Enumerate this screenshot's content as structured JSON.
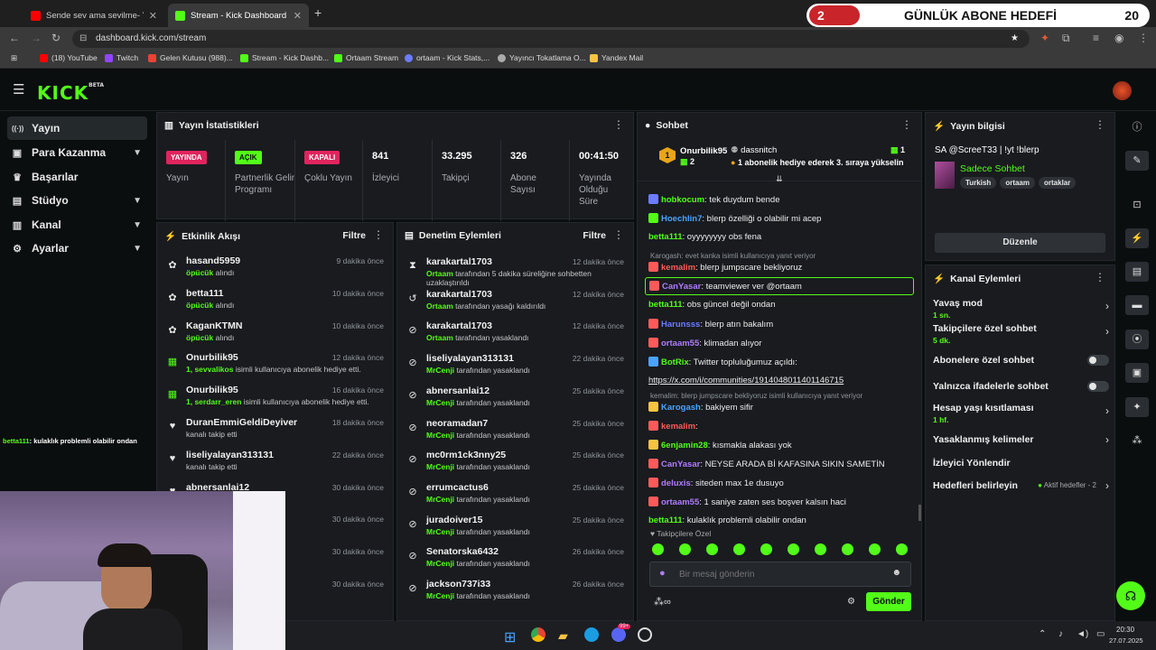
{
  "browser": {
    "tabs": [
      {
        "title": "Sende sev ama sevilme- Yıldız T",
        "active": false,
        "favicon_color": "#ff0000"
      },
      {
        "title": "Stream - Kick Dashboard",
        "active": true,
        "favicon_color": "#53fc18"
      }
    ],
    "url": "dashboard.kick.com/stream",
    "bookmarks": [
      {
        "label": "(18) YouTube",
        "color": "#ff0000"
      },
      {
        "label": "Twitch",
        "color": "#9146ff"
      },
      {
        "label": "Gelen Kutusu (988)...",
        "color": "#ea4335"
      },
      {
        "label": "Stream - Kick Dashb...",
        "color": "#53fc18"
      },
      {
        "label": "Ortaam Stream",
        "color": "#53fc18"
      },
      {
        "label": "ortaam - Kick Stats,...",
        "color": "#6b7cff"
      },
      {
        "label": "Yayıncı Tokatlama O...",
        "color": "#aaaaaa"
      },
      {
        "label": "Yandex Mail",
        "color": "#f6c343"
      }
    ]
  },
  "goal_overlay": {
    "number": "2",
    "label": "GÜNLÜK ABONE HEDEFİ",
    "count": "20"
  },
  "logo": {
    "text": "KICK",
    "beta": "BETA"
  },
  "nav": [
    {
      "label": "Yayın",
      "icon": "radio-icon",
      "glyph": "((·))",
      "active": true,
      "chevron": false
    },
    {
      "label": "Para Kazanma",
      "icon": "money-icon",
      "glyph": "▣",
      "active": false,
      "chevron": true
    },
    {
      "label": "Başarılar",
      "icon": "trophy-icon",
      "glyph": "♛",
      "active": false,
      "chevron": false
    },
    {
      "label": "Stüdyo",
      "icon": "studio-icon",
      "glyph": "▤",
      "active": false,
      "chevron": true
    },
    {
      "label": "Kanal",
      "icon": "channel-icon",
      "glyph": "▥",
      "active": false,
      "chevron": true
    },
    {
      "label": "Ayarlar",
      "icon": "settings-icon",
      "glyph": "⚙",
      "active": false,
      "chevron": true
    }
  ],
  "stats_panel": {
    "title": "Yayın İstatistikleri",
    "items": [
      {
        "badge": "YAYINDA",
        "badge_color": "#e0245e",
        "label": "Yayın"
      },
      {
        "badge": "AÇIK",
        "badge_color": "#53fc18",
        "label": "Partnerlik Gelir Programı"
      },
      {
        "badge": "KAPALI",
        "badge_color": "#e0245e",
        "label": "Çoklu Yayın"
      },
      {
        "value": "841",
        "label": "İzleyici"
      },
      {
        "value": "33.295",
        "label": "Takipçi"
      },
      {
        "value": "326",
        "label": "Abone Sayısı"
      },
      {
        "value": "00:41:50",
        "label": "Yayında Olduğu Süre"
      }
    ]
  },
  "activity": {
    "title": "Etkinlik Akışı",
    "filter": "Filtre",
    "rows": [
      {
        "name": "hasand5959",
        "sub_hl": "öpücük",
        "sub": " alındı",
        "time": "9 dakika önce",
        "icon": "gift-icon",
        "glyph": "✿"
      },
      {
        "name": "betta111",
        "sub_hl": "öpücük",
        "sub": " alındı",
        "time": "10 dakika önce",
        "icon": "gift-icon",
        "glyph": "✿"
      },
      {
        "name": "KaganKTMN",
        "sub_hl": "öpücük",
        "sub": " alındı",
        "time": "10 dakika önce",
        "icon": "gift-icon",
        "glyph": "✿"
      },
      {
        "name": "Onurbilik95",
        "sub_hl": "1, sevvalikos",
        "sub": " isimli kullanıcıya abonelik hediye etti.",
        "time": "12 dakika önce",
        "icon": "sub-gift-icon",
        "glyph": "▦"
      },
      {
        "name": "Onurbilik95",
        "sub_hl": "1, serdarr_eren",
        "sub": " isimli kullanıcıya abonelik hediye etti.",
        "time": "16 dakika önce",
        "icon": "sub-gift-icon",
        "glyph": "▦"
      },
      {
        "name": "DuranEmmiGeldiDeyiver",
        "sub_hl": "",
        "sub": "kanalı takip etti",
        "time": "18 dakika önce",
        "icon": "heart-icon",
        "glyph": "♥"
      },
      {
        "name": "liseliyalayan313131",
        "sub_hl": "",
        "sub": "kanalı takip etti",
        "time": "22 dakika önce",
        "icon": "heart-icon",
        "glyph": "♥"
      },
      {
        "name": "abnersanlai12",
        "sub_hl": "",
        "sub": "",
        "time": "30 dakika önce",
        "icon": "heart-icon",
        "glyph": "♥"
      },
      {
        "name": "",
        "sub_hl": "",
        "sub": "",
        "time": "30 dakika önce",
        "icon": "heart-icon",
        "glyph": ""
      },
      {
        "name": "",
        "sub_hl": "",
        "sub": "",
        "time": "30 dakika önce",
        "icon": "heart-icon",
        "glyph": ""
      },
      {
        "name": "",
        "sub_hl": "",
        "sub": "",
        "time": "30 dakika önce",
        "icon": "heart-icon",
        "glyph": ""
      }
    ]
  },
  "moderation": {
    "title": "Denetim Eylemleri",
    "filter": "Filtre",
    "rows": [
      {
        "name": "karakartal1703",
        "sub_hl": "Ortaam",
        "sub": " tarafından 5 dakika süreliğine sohbetten uzaklaştırıldı",
        "time": "12 dakika önce",
        "glyph": "⧗"
      },
      {
        "name": "karakartal1703",
        "sub_hl": "Ortaam",
        "sub": " tarafından yasağı kaldırıldı",
        "time": "12 dakika önce",
        "glyph": "↺"
      },
      {
        "name": "karakartal1703",
        "sub_hl": "Ortaam",
        "sub": " tarafından yasaklandı",
        "time": "12 dakika önce",
        "glyph": "⊘"
      },
      {
        "name": "liseliyalayan313131",
        "sub_hl": "MrCenji",
        "sub": " tarafından yasaklandı",
        "time": "22 dakika önce",
        "glyph": "⊘"
      },
      {
        "name": "abnersanlai12",
        "sub_hl": "MrCenji",
        "sub": " tarafından yasaklandı",
        "time": "25 dakika önce",
        "glyph": "⊘"
      },
      {
        "name": "neoramadan7",
        "sub_hl": "MrCenji",
        "sub": " tarafından yasaklandı",
        "time": "25 dakika önce",
        "glyph": "⊘"
      },
      {
        "name": "mc0rm1ck3nny25",
        "sub_hl": "MrCenji",
        "sub": " tarafından yasaklandı",
        "time": "25 dakika önce",
        "glyph": "⊘"
      },
      {
        "name": "errumcactus6",
        "sub_hl": "MrCenji",
        "sub": " tarafından yasaklandı",
        "time": "25 dakika önce",
        "glyph": "⊘"
      },
      {
        "name": "juradoiver15",
        "sub_hl": "MrCenji",
        "sub": " tarafından yasaklandı",
        "time": "25 dakika önce",
        "glyph": "⊘"
      },
      {
        "name": "Senatorska6432",
        "sub_hl": "MrCenji",
        "sub": " tarafından yasaklandı",
        "time": "26 dakika önce",
        "glyph": "⊘"
      },
      {
        "name": "jackson737i33",
        "sub_hl": "MrCenji",
        "sub": " tarafından yasaklandı",
        "time": "26 dakika önce",
        "glyph": "⊘"
      }
    ]
  },
  "chat": {
    "title": "Sohbet",
    "pinned_left": {
      "rank": "1",
      "name": "Onurbilik95",
      "count": "2"
    },
    "pinned_right": {
      "name": "dassnitch",
      "count": "1",
      "text": "1 abonelik hediye ederek 3. sıraya yükselin"
    },
    "messages": [
      {
        "reply": "",
        "user": "hobkocum",
        "color": "#53fc18",
        "text": ": tek duydum bende",
        "badge": "#6b7cff"
      },
      {
        "reply": "",
        "user": "Hoechlin7",
        "color": "#4aa3ff",
        "text": ": blerp özelliği o olabilir mi acep",
        "badge": "#53fc18"
      },
      {
        "reply": "",
        "user": "betta111",
        "color": "#53fc18",
        "text": ": oyyyyyyyy obs fena",
        "badge": ""
      },
      {
        "reply": "Karogash: evet kanka isimli kullanıcıya yanıt veriyor",
        "user": "kemalim",
        "color": "#ff5a5a",
        "text": ": blerp jumpscare bekliyoruz",
        "badge": "#ff5a5a"
      },
      {
        "reply": "",
        "user": "CanYasar",
        "color": "#b07cff",
        "text": ": teamviewer ver @ortaam",
        "badge": "#ff5a5a",
        "highlight": true
      },
      {
        "reply": "",
        "user": "betta111",
        "color": "#53fc18",
        "text": ": obs güncel değil ondan",
        "badge": ""
      },
      {
        "reply": "",
        "user": "Harunsss",
        "color": "#6b7cff",
        "text": ": blerp atın bakalım",
        "badge": "#ff5a5a"
      },
      {
        "reply": "",
        "user": "ortaam55",
        "color": "#b07cff",
        "text": ": klimadan alıyor",
        "badge": "#ff5a5a"
      },
      {
        "reply": "",
        "user": "BotRix",
        "color": "#53fc18",
        "text": ": Twitter topluluğumuz açıldı:",
        "badge": "#4aa3ff"
      },
      {
        "reply": "",
        "user": "",
        "color": "#ffffff",
        "text": "https://x.com/i/communities/1914048011401146715",
        "badge": "",
        "link": true
      },
      {
        "reply": "kemalim: blerp jumpscare bekliyoruz isimli kullanıcıya yanıt veriyor",
        "user": "Karogash",
        "color": "#4aa3ff",
        "text": ": bakiyem sifir",
        "badge": "#f6c343"
      },
      {
        "reply": "",
        "user": "kemalim",
        "color": "#ff5a5a",
        "text": ":",
        "badge": "#ff5a5a"
      },
      {
        "reply": "",
        "user": "6enjamin28",
        "color": "#53fc18",
        "text": ": kısmakla alakası yok",
        "badge": "#f6c343"
      },
      {
        "reply": "",
        "user": "CanYasar",
        "color": "#b07cff",
        "text": ": NEYSE ARADA Bİ KAFASINA SIKIN SAMETİN",
        "badge": "#ff5a5a"
      },
      {
        "reply": "",
        "user": "deluxis",
        "color": "#b07cff",
        "text": ": siteden max 1e dusuyo",
        "badge": "#ff5a5a"
      },
      {
        "reply": "",
        "user": "ortaam55",
        "color": "#b07cff",
        "text": ": 1 saniye zaten ses boşver kalsın haci",
        "badge": "#ff5a5a"
      },
      {
        "reply": "",
        "user": "betta111",
        "color": "#53fc18",
        "text": ": kulaklık problemli olabilir ondan",
        "badge": ""
      }
    ],
    "followers_only": "Takipçilere Özel",
    "input_placeholder": "Bir mesaj gönderin",
    "send": "Gönder"
  },
  "stream_info": {
    "title": "Yayın bilgisi",
    "stream_title": "SA @ScreeT33 | !yt !blerp",
    "category": "Sadece Sohbet",
    "tags": [
      "Turkish",
      "ortaam",
      "ortaklar"
    ],
    "edit": "Düzenle"
  },
  "channel_actions": {
    "title": "Kanal Eylemleri",
    "rows": [
      {
        "label": "Yavaş mod",
        "sub": "1 sn.",
        "control": "chevron"
      },
      {
        "label": "Takipçilere özel sohbet",
        "sub": "5 dk.",
        "control": "chevron"
      },
      {
        "label": "Abonelere özel sohbet",
        "sub": "",
        "control": "toggle"
      },
      {
        "label": "Yalnızca ifadelerle sohbet",
        "sub": "",
        "control": "toggle"
      },
      {
        "label": "Hesap yaşı kısıtlaması",
        "sub": "1 hf.",
        "control": "chevron"
      },
      {
        "label": "Yasaklanmış kelimeler",
        "sub": "",
        "control": "chevron"
      },
      {
        "label": "İzleyici Yönlendir",
        "sub": "",
        "control": "none"
      },
      {
        "label": "Hedefleri belirleyin",
        "sub": "",
        "control": "chevron",
        "extra": "Aktif hedefler - 2"
      }
    ]
  },
  "overlay_chat": {
    "user": "betta111",
    "text": ": kulaklık problemli olabilir ondan"
  },
  "taskbar": {
    "time": "20:30",
    "date": "27.07.2025",
    "badge": "99+"
  }
}
